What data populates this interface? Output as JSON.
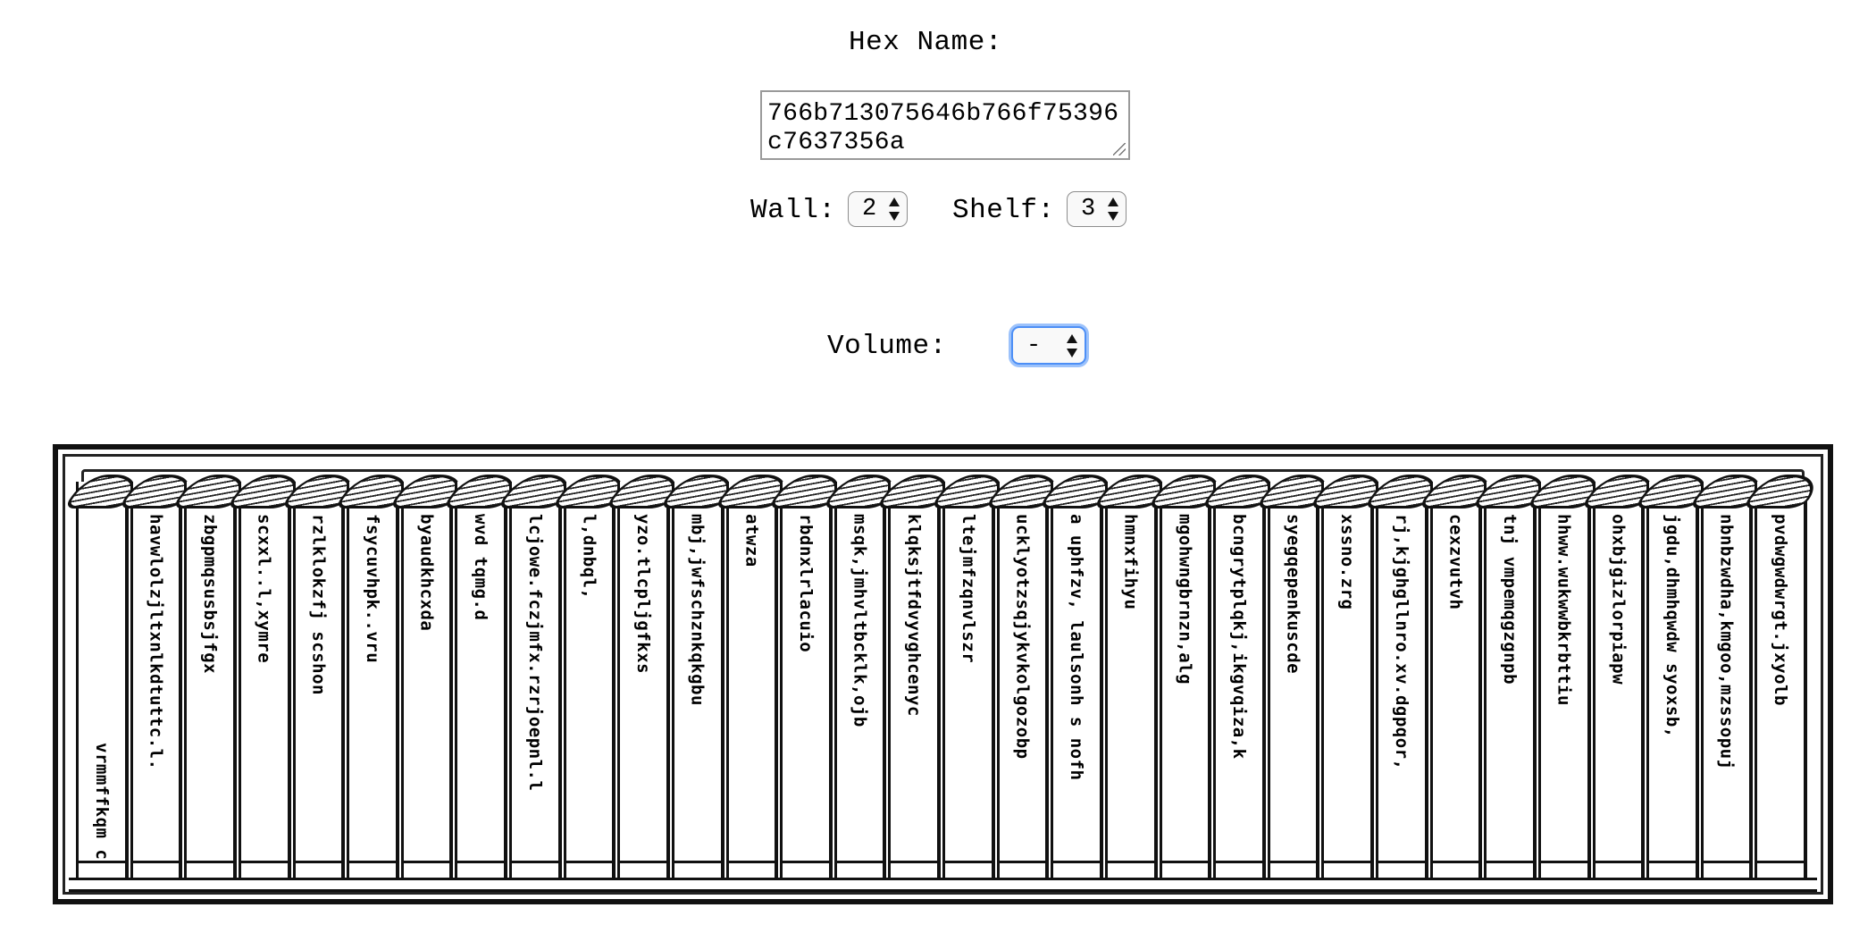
{
  "hex": {
    "label": "Hex Name:",
    "value": "766b713075646b766f75396c7637356a"
  },
  "wall": {
    "label": "Wall:",
    "value": "2"
  },
  "shelf": {
    "label": "Shelf:",
    "value": "3"
  },
  "volume": {
    "label": "Volume:",
    "value": "-"
  },
  "books": [
    {
      "title": "vrmmffkqm c",
      "align": "bottom"
    },
    {
      "title": "havwlolzjltxnlkdtuttc.l.",
      "align": "top"
    },
    {
      "title": "zbgpmqsusbsjfgx",
      "align": "top"
    },
    {
      "title": "scxxl..l,xymre",
      "align": "top"
    },
    {
      "title": "rzlklokzfj scshon",
      "align": "top"
    },
    {
      "title": "fsycuvhpk..vru",
      "align": "top"
    },
    {
      "title": "byaudkhcxda",
      "align": "top"
    },
    {
      "title": "wvd tqmg.d",
      "align": "top"
    },
    {
      "title": "lcjowe.fczjmfx.rzrjoepnl.l",
      "align": "top"
    },
    {
      "title": "l,dnbql,",
      "align": "top"
    },
    {
      "title": "yzo.tlcpljgfkxs",
      "align": "top"
    },
    {
      "title": "mbj,jwfschznkqkgbu",
      "align": "top"
    },
    {
      "title": "atwza",
      "align": "top"
    },
    {
      "title": "rbdnxlrlacuio",
      "align": "top"
    },
    {
      "title": "msqk,jmhvltbcklk,ojb",
      "align": "top"
    },
    {
      "title": "klqksjtfdvyvghcenyc",
      "align": "top"
    },
    {
      "title": "ltejmfzqnvlszr",
      "align": "top"
    },
    {
      "title": "ucklyotzsqjykvkolgozobp",
      "align": "top"
    },
    {
      "title": "a uphfzv, laulsonh s nofh",
      "align": "top"
    },
    {
      "title": "hmnxfihyu",
      "align": "top"
    },
    {
      "title": "mgohwngbrnzn,alg",
      "align": "top"
    },
    {
      "title": "bcngrytplqkj,ikgvqiza,k",
      "align": "top"
    },
    {
      "title": "syegqepenkuscde",
      "align": "top"
    },
    {
      "title": "xssno.zrg",
      "align": "top"
    },
    {
      "title": "rj,kjghgllnro.xv.dgpqor,",
      "align": "top"
    },
    {
      "title": "cexzvutvh",
      "align": "top"
    },
    {
      "title": "tnj vmpemqgzgnpb",
      "align": "top"
    },
    {
      "title": "hhww.wukwwbkrbttiu",
      "align": "top"
    },
    {
      "title": "ohxbjgizlorpiapw",
      "align": "top"
    },
    {
      "title": "jgdu,dhmhqwdw syoxsb,",
      "align": "top"
    },
    {
      "title": "nbnbzwdha,kmgoo,mzssopuj",
      "align": "top"
    },
    {
      "title": "pvdwgwdwrgt.jxyolb",
      "align": "top"
    }
  ]
}
